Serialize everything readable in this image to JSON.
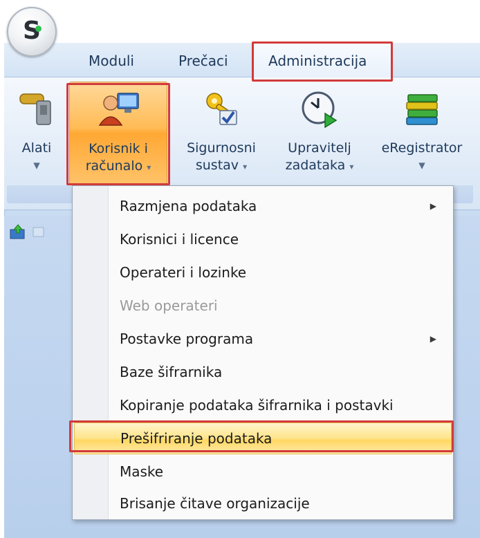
{
  "app": {
    "logo_letter": "S"
  },
  "tabs": [
    {
      "label": "Moduli"
    },
    {
      "label": "Prečaci"
    },
    {
      "label": "Administracija"
    }
  ],
  "ribbon": {
    "buttons": [
      {
        "line1": "Alati",
        "line2": "",
        "icon": "tools-icon"
      },
      {
        "line1": "Korisnik i",
        "line2": "računalo",
        "icon": "user-computer-icon"
      },
      {
        "line1": "Sigurnosni",
        "line2": "sustav",
        "icon": "security-key-icon"
      },
      {
        "line1": "Upravitelj",
        "line2": "zadataka",
        "icon": "task-clock-icon"
      },
      {
        "line1": "eRegistrator",
        "line2": "",
        "icon": "books-icon"
      }
    ],
    "dropdown_arrow": "▾"
  },
  "menu": {
    "items": [
      {
        "label": "Razmjena podataka",
        "submenu": true,
        "disabled": false
      },
      {
        "label": "Korisnici i licence",
        "submenu": false,
        "disabled": false
      },
      {
        "label": "Operateri i lozinke",
        "submenu": false,
        "disabled": false
      },
      {
        "label": "Web operateri",
        "submenu": false,
        "disabled": true
      },
      {
        "label": "Postavke programa",
        "submenu": true,
        "disabled": false
      },
      {
        "label": "Baze šifrarnika",
        "submenu": false,
        "disabled": false
      },
      {
        "label": "Kopiranje podataka šifrarnika i postavki",
        "submenu": false,
        "disabled": false
      },
      {
        "label": "Prešifriranje podataka",
        "submenu": false,
        "disabled": false,
        "selected": true
      },
      {
        "label": "Maske",
        "submenu": false,
        "disabled": false
      },
      {
        "label": "Brisanje čitave organizacije",
        "submenu": false,
        "disabled": false
      }
    ],
    "submenu_arrow": "▶"
  },
  "colors": {
    "highlight_border": "#d23a3a",
    "selected_item": "#ffd862",
    "active_ribbon_button": "#ffa834"
  }
}
